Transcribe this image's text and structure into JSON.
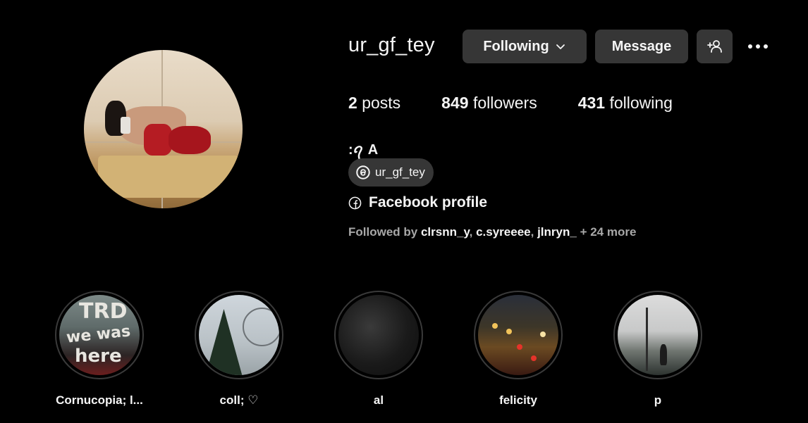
{
  "profile": {
    "username": "ur_gf_tey",
    "buttons": {
      "following": "Following",
      "message": "Message"
    },
    "stats": {
      "posts_count": "2",
      "posts_label": "posts",
      "followers_count": "849",
      "followers_label": "followers",
      "following_count": "431",
      "following_label": "following"
    },
    "bio_name": ":ꪖ A",
    "threads_handle": "ur_gf_tey",
    "facebook_link": "Facebook profile",
    "followed_by": {
      "prefix": "Followed by",
      "names": [
        "clrsnn_y",
        "c.syreeee",
        "jlnryn_"
      ],
      "more": "+ 24 more"
    }
  },
  "highlights": [
    {
      "label": "Cornucopia; l..."
    },
    {
      "label": "coll; ♡"
    },
    {
      "label": "al"
    },
    {
      "label": "felicity"
    },
    {
      "label": "p"
    }
  ],
  "icons": {
    "chevron": "chevron-down-icon",
    "add_user": "add-user-icon",
    "more": "more-options-icon",
    "threads": "threads-icon",
    "facebook": "facebook-icon"
  },
  "theme": {
    "background": "#000000",
    "button_bg": "#363636",
    "text_primary": "#f5f5f5",
    "text_secondary": "#a8a8a8"
  }
}
